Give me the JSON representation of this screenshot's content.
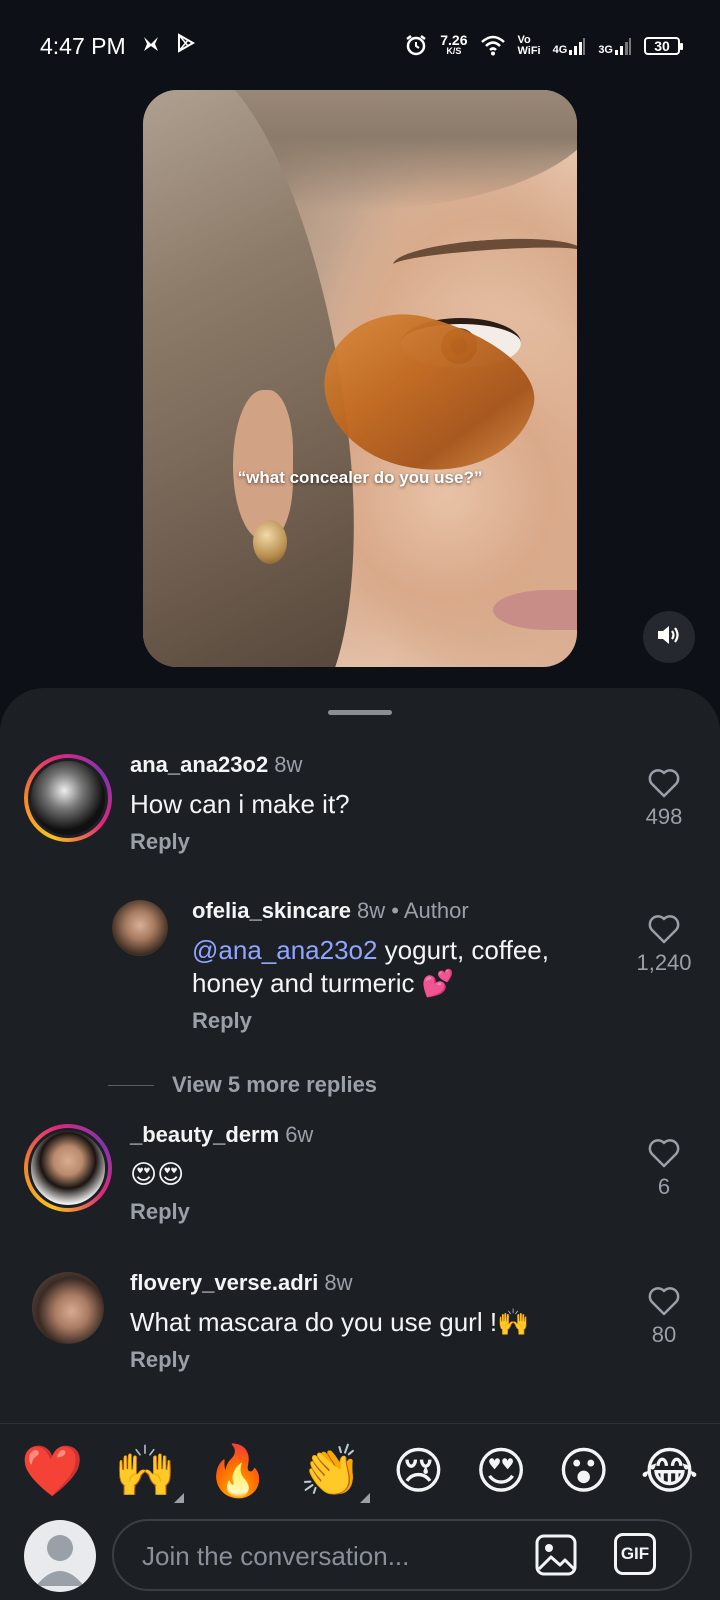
{
  "status_bar": {
    "time": "4:47 PM",
    "net_speed_value": "7.26",
    "net_speed_unit": "K/S",
    "vowifi_top": "Vo",
    "vowifi_bottom": "WiFi",
    "signal1_label": "4G",
    "signal2_label": "3G",
    "battery": "30"
  },
  "video": {
    "caption": "“what concealer do you use?”"
  },
  "comments": [
    {
      "username": "ana_ana23o2",
      "time": "8w",
      "text": "How can i make it?",
      "reply_label": "Reply",
      "likes": "498"
    },
    {
      "username": "ofelia_skincare",
      "time": "8w",
      "separator": "•",
      "author_label": "Author",
      "mention": "@ana_ana23o2",
      "text": " yogurt, coffee, honey and turmeric 💕",
      "reply_label": "Reply",
      "likes": "1,240"
    },
    {
      "username": "_beauty_derm",
      "time": "6w",
      "text": "😍😍",
      "reply_label": "Reply",
      "likes": "6"
    },
    {
      "username": "flovery_verse.adri",
      "time": "8w",
      "text": "What mascara do you use gurl !🙌",
      "reply_label": "Reply",
      "likes": "80"
    }
  ],
  "view_more_replies": "View 5 more replies",
  "reactions": [
    "❤️",
    "🙌",
    "🔥",
    "👏",
    "😢",
    "😍",
    "😮",
    "😂"
  ],
  "composer": {
    "placeholder": "Join the conversation...",
    "gif_label": "GIF"
  }
}
